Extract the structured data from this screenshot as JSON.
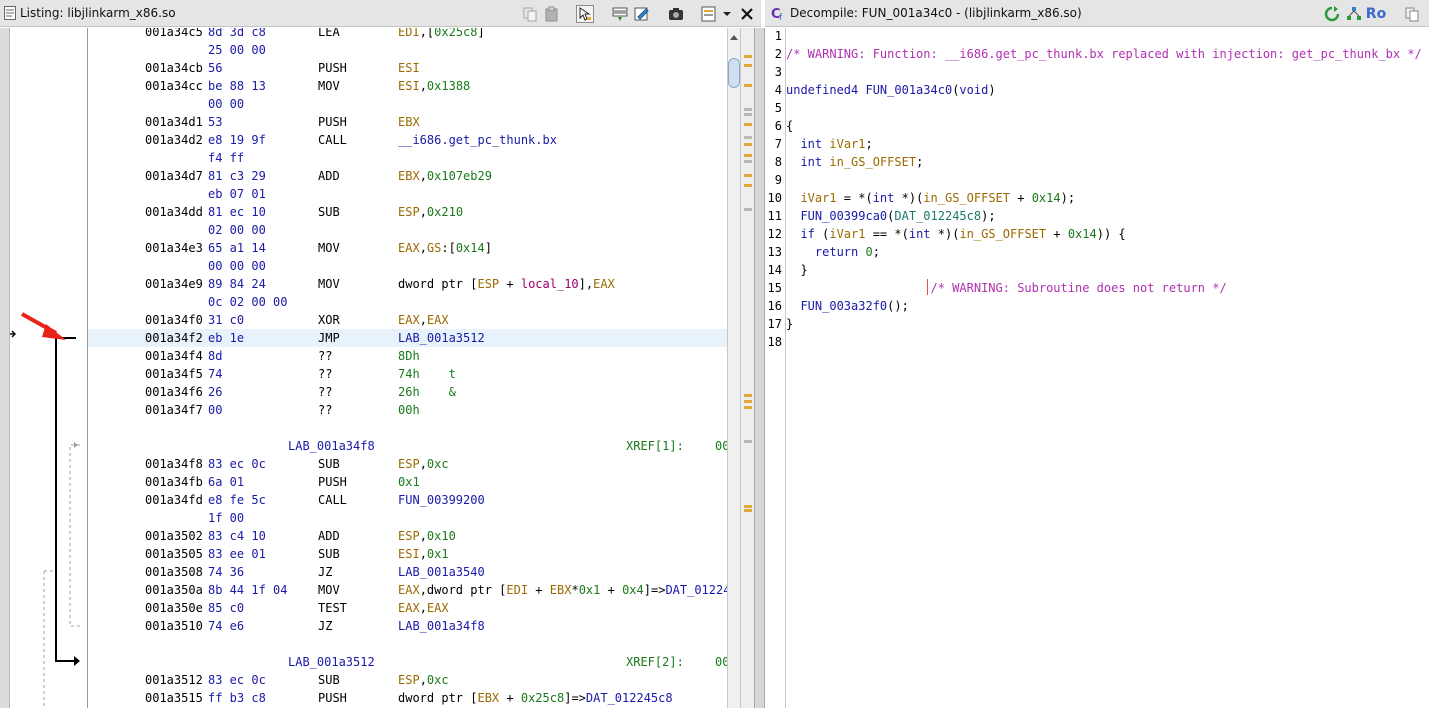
{
  "listing": {
    "title": "Listing:  libjlinkarm_x86.so",
    "rows": [
      {
        "addr": "001a34c5",
        "bytes": "8d 3d c8",
        "mn": "LEA",
        "ops": [
          {
            "t": "EDI",
            "c": "reg"
          },
          {
            "t": ",[",
            "c": "plain"
          },
          {
            "t": "0x25c8",
            "c": "num"
          },
          {
            "t": "]",
            "c": "plain"
          }
        ]
      },
      {
        "addr": "",
        "bytes": "25 00 00",
        "mn": "",
        "ops": []
      },
      {
        "addr": "001a34cb",
        "bytes": "56",
        "mn": "PUSH",
        "ops": [
          {
            "t": "ESI",
            "c": "reg"
          }
        ]
      },
      {
        "addr": "001a34cc",
        "bytes": "be 88 13",
        "mn": "MOV",
        "ops": [
          {
            "t": "ESI",
            "c": "reg"
          },
          {
            "t": ",",
            "c": "plain"
          },
          {
            "t": "0x1388",
            "c": "num"
          }
        ]
      },
      {
        "addr": "",
        "bytes": "00 00",
        "mn": "",
        "ops": []
      },
      {
        "addr": "001a34d1",
        "bytes": "53",
        "mn": "PUSH",
        "ops": [
          {
            "t": "EBX",
            "c": "reg"
          }
        ]
      },
      {
        "addr": "001a34d2",
        "bytes": "e8 19 9f",
        "mn": "CALL",
        "ops": [
          {
            "t": "__i686.get_pc_thunk.bx",
            "c": "fn"
          }
        ]
      },
      {
        "addr": "",
        "bytes": "f4 ff",
        "mn": "",
        "ops": []
      },
      {
        "addr": "001a34d7",
        "bytes": "81 c3 29",
        "mn": "ADD",
        "ops": [
          {
            "t": "EBX",
            "c": "reg"
          },
          {
            "t": ",",
            "c": "plain"
          },
          {
            "t": "0x107eb29",
            "c": "num"
          }
        ]
      },
      {
        "addr": "",
        "bytes": "eb 07 01",
        "mn": "",
        "ops": []
      },
      {
        "addr": "001a34dd",
        "bytes": "81 ec 10",
        "mn": "SUB",
        "ops": [
          {
            "t": "ESP",
            "c": "reg"
          },
          {
            "t": ",",
            "c": "plain"
          },
          {
            "t": "0x210",
            "c": "num"
          }
        ]
      },
      {
        "addr": "",
        "bytes": "02 00 00",
        "mn": "",
        "ops": []
      },
      {
        "addr": "001a34e3",
        "bytes": "65 a1 14",
        "mn": "MOV",
        "ops": [
          {
            "t": "EAX",
            "c": "reg"
          },
          {
            "t": ",",
            "c": "plain"
          },
          {
            "t": "GS",
            "c": "reg"
          },
          {
            "t": ":[",
            "c": "plain"
          },
          {
            "t": "0x14",
            "c": "num"
          },
          {
            "t": "]",
            "c": "plain"
          }
        ]
      },
      {
        "addr": "",
        "bytes": "00 00 00",
        "mn": "",
        "ops": []
      },
      {
        "addr": "001a34e9",
        "bytes": "89 84 24",
        "mn": "MOV",
        "ops": [
          {
            "t": "dword ptr [",
            "c": "plain"
          },
          {
            "t": "ESP",
            "c": "reg"
          },
          {
            "t": " + ",
            "c": "plain"
          },
          {
            "t": "local_10",
            "c": "loc"
          },
          {
            "t": "],",
            "c": "plain"
          },
          {
            "t": "EAX",
            "c": "reg"
          }
        ]
      },
      {
        "addr": "",
        "bytes": "0c 02 00 00",
        "mn": "",
        "ops": []
      },
      {
        "addr": "001a34f0",
        "bytes": "31 c0",
        "mn": "XOR",
        "ops": [
          {
            "t": "EAX",
            "c": "reg"
          },
          {
            "t": ",",
            "c": "plain"
          },
          {
            "t": "EAX",
            "c": "reg"
          }
        ]
      },
      {
        "addr": "001a34f2",
        "bytes": "eb 1e",
        "mn": "JMP",
        "ops": [
          {
            "t": "LAB_001a3512",
            "c": "fn"
          }
        ],
        "cursor": true
      },
      {
        "addr": "001a34f4",
        "bytes": "8d",
        "mn": "??",
        "ops": [
          {
            "t": "8Dh",
            "c": "num"
          }
        ]
      },
      {
        "addr": "001a34f5",
        "bytes": "74",
        "mn": "??",
        "ops": [
          {
            "t": "74h    t",
            "c": "num"
          }
        ]
      },
      {
        "addr": "001a34f6",
        "bytes": "26",
        "mn": "??",
        "ops": [
          {
            "t": "26h    &",
            "c": "num"
          }
        ]
      },
      {
        "addr": "001a34f7",
        "bytes": "00",
        "mn": "??",
        "ops": [
          {
            "t": "00h",
            "c": "num"
          }
        ]
      },
      {
        "blank": true
      },
      {
        "label": "LAB_001a34f8",
        "xref": "XREF[1]:",
        "xref2": "00"
      },
      {
        "addr": "001a34f8",
        "bytes": "83 ec 0c",
        "mn": "SUB",
        "ops": [
          {
            "t": "ESP",
            "c": "reg"
          },
          {
            "t": ",",
            "c": "plain"
          },
          {
            "t": "0xc",
            "c": "num"
          }
        ]
      },
      {
        "addr": "001a34fb",
        "bytes": "6a 01",
        "mn": "PUSH",
        "ops": [
          {
            "t": "0x1",
            "c": "num"
          }
        ]
      },
      {
        "addr": "001a34fd",
        "bytes": "e8 fe 5c",
        "mn": "CALL",
        "ops": [
          {
            "t": "FUN_00399200",
            "c": "fn"
          }
        ]
      },
      {
        "addr": "",
        "bytes": "1f 00",
        "mn": "",
        "ops": []
      },
      {
        "addr": "001a3502",
        "bytes": "83 c4 10",
        "mn": "ADD",
        "ops": [
          {
            "t": "ESP",
            "c": "reg"
          },
          {
            "t": ",",
            "c": "plain"
          },
          {
            "t": "0x10",
            "c": "num"
          }
        ]
      },
      {
        "addr": "001a3505",
        "bytes": "83 ee 01",
        "mn": "SUB",
        "ops": [
          {
            "t": "ESI",
            "c": "reg"
          },
          {
            "t": ",",
            "c": "plain"
          },
          {
            "t": "0x1",
            "c": "num"
          }
        ]
      },
      {
        "addr": "001a3508",
        "bytes": "74 36",
        "mn": "JZ",
        "ops": [
          {
            "t": "LAB_001a3540",
            "c": "fn"
          }
        ]
      },
      {
        "addr": "001a350a",
        "bytes": "8b 44 1f 04",
        "mn": "MOV",
        "ops": [
          {
            "t": "EAX",
            "c": "reg"
          },
          {
            "t": ",dword ptr [",
            "c": "plain"
          },
          {
            "t": "EDI",
            "c": "reg"
          },
          {
            "t": " + ",
            "c": "plain"
          },
          {
            "t": "EBX",
            "c": "reg"
          },
          {
            "t": "*",
            "c": "plain"
          },
          {
            "t": "0x1",
            "c": "num"
          },
          {
            "t": " + ",
            "c": "plain"
          },
          {
            "t": "0x4",
            "c": "num"
          },
          {
            "t": "]=>",
            "c": "plain"
          },
          {
            "t": "DAT_01224…",
            "c": "fn"
          }
        ]
      },
      {
        "addr": "001a350e",
        "bytes": "85 c0",
        "mn": "TEST",
        "ops": [
          {
            "t": "EAX",
            "c": "reg"
          },
          {
            "t": ",",
            "c": "plain"
          },
          {
            "t": "EAX",
            "c": "reg"
          }
        ]
      },
      {
        "addr": "001a3510",
        "bytes": "74 e6",
        "mn": "JZ",
        "ops": [
          {
            "t": "LAB_001a34f8",
            "c": "fn"
          }
        ]
      },
      {
        "blank": true
      },
      {
        "label": "LAB_001a3512",
        "xref": "XREF[2]:",
        "xref2": "00"
      },
      {
        "addr": "001a3512",
        "bytes": "83 ec 0c",
        "mn": "SUB",
        "ops": [
          {
            "t": "ESP",
            "c": "reg"
          },
          {
            "t": ",",
            "c": "plain"
          },
          {
            "t": "0xc",
            "c": "num"
          }
        ]
      },
      {
        "addr": "001a3515",
        "bytes": "ff b3 c8",
        "mn": "PUSH",
        "ops": [
          {
            "t": "dword ptr [",
            "c": "plain"
          },
          {
            "t": "EBX",
            "c": "reg"
          },
          {
            "t": " + ",
            "c": "plain"
          },
          {
            "t": "0x25c8",
            "c": "num"
          },
          {
            "t": "]=>",
            "c": "plain"
          },
          {
            "t": "DAT_012245c8",
            "c": "fn"
          }
        ]
      }
    ]
  },
  "decompile": {
    "title": "Decompile: FUN_001a34c0 -  (libjlinkarm_x86.so)",
    "ro_label": "Ro",
    "lines": [
      {
        "n": "1",
        "segs": []
      },
      {
        "n": "2",
        "segs": [
          {
            "t": "/* WARNING: Function: __i686.get_pc_thunk.bx replaced with injection: get_pc_thunk_bx */",
            "c": "cmt"
          }
        ]
      },
      {
        "n": "3",
        "segs": []
      },
      {
        "n": "4",
        "segs": [
          {
            "t": "undefined4 ",
            "c": "kw"
          },
          {
            "t": "FUN_001a34c0",
            "c": "fn"
          },
          {
            "t": "(",
            "c": "plain"
          },
          {
            "t": "void",
            "c": "kw"
          },
          {
            "t": ")",
            "c": "plain"
          }
        ]
      },
      {
        "n": "5",
        "segs": []
      },
      {
        "n": "6",
        "segs": [
          {
            "t": "{",
            "c": "plain"
          }
        ]
      },
      {
        "n": "7",
        "segs": [
          {
            "t": "  ",
            "c": "plain"
          },
          {
            "t": "int",
            "c": "kw"
          },
          {
            "t": " ",
            "c": "plain"
          },
          {
            "t": "iVar1",
            "c": "var"
          },
          {
            "t": ";",
            "c": "plain"
          }
        ]
      },
      {
        "n": "8",
        "segs": [
          {
            "t": "  ",
            "c": "plain"
          },
          {
            "t": "int",
            "c": "kw"
          },
          {
            "t": " ",
            "c": "plain"
          },
          {
            "t": "in_GS_OFFSET",
            "c": "var"
          },
          {
            "t": ";",
            "c": "plain"
          }
        ]
      },
      {
        "n": "9",
        "segs": []
      },
      {
        "n": "10",
        "segs": [
          {
            "t": "  ",
            "c": "plain"
          },
          {
            "t": "iVar1",
            "c": "var"
          },
          {
            "t": " = *(",
            "c": "plain"
          },
          {
            "t": "int",
            "c": "kw"
          },
          {
            "t": " *)(",
            "c": "plain"
          },
          {
            "t": "in_GS_OFFSET",
            "c": "var"
          },
          {
            "t": " + ",
            "c": "plain"
          },
          {
            "t": "0x14",
            "c": "num"
          },
          {
            "t": ");",
            "c": "plain"
          }
        ]
      },
      {
        "n": "11",
        "segs": [
          {
            "t": "  ",
            "c": "plain"
          },
          {
            "t": "FUN_00399ca0",
            "c": "fn"
          },
          {
            "t": "(",
            "c": "plain"
          },
          {
            "t": "DAT_012245c8",
            "c": "glob"
          },
          {
            "t": ");",
            "c": "plain"
          }
        ]
      },
      {
        "n": "12",
        "segs": [
          {
            "t": "  ",
            "c": "plain"
          },
          {
            "t": "if",
            "c": "kw"
          },
          {
            "t": " (",
            "c": "plain"
          },
          {
            "t": "iVar1",
            "c": "var"
          },
          {
            "t": " == *(",
            "c": "plain"
          },
          {
            "t": "int",
            "c": "kw"
          },
          {
            "t": " *)(",
            "c": "plain"
          },
          {
            "t": "in_GS_OFFSET",
            "c": "var"
          },
          {
            "t": " + ",
            "c": "plain"
          },
          {
            "t": "0x14",
            "c": "num"
          },
          {
            "t": ")) {",
            "c": "plain"
          }
        ]
      },
      {
        "n": "13",
        "segs": [
          {
            "t": "    ",
            "c": "plain"
          },
          {
            "t": "return",
            "c": "kw"
          },
          {
            "t": " ",
            "c": "plain"
          },
          {
            "t": "0",
            "c": "num"
          },
          {
            "t": ";",
            "c": "plain"
          }
        ]
      },
      {
        "n": "14",
        "segs": [
          {
            "t": "  }",
            "c": "plain"
          }
        ]
      },
      {
        "n": "15",
        "segs": [
          {
            "t": "                    /* WARNING: Subroutine does not return */",
            "c": "cmt"
          }
        ]
      },
      {
        "n": "16",
        "segs": [
          {
            "t": "  ",
            "c": "plain"
          },
          {
            "t": "FUN_003a32f0",
            "c": "fn"
          },
          {
            "t": "();",
            "c": "plain"
          }
        ]
      },
      {
        "n": "17",
        "segs": [
          {
            "t": "}",
            "c": "plain"
          }
        ]
      },
      {
        "n": "18",
        "segs": []
      }
    ]
  },
  "icons": {
    "listing": [
      "copy-icon",
      "paste-icon",
      "cursor-select-icon",
      "field-edit-icon",
      "byte-edit-icon",
      "snapshot-icon",
      "navigation-icon",
      "menu-chevron-icon",
      "close-icon"
    ],
    "decompile": [
      "refresh-icon",
      "graph-icon",
      "ro-toggle",
      "copy-window-icon"
    ]
  },
  "colors": {
    "register": "#9a6a00",
    "number": "#1a7a1a",
    "function": "#1a1aa8",
    "comment": "#b030b0",
    "arrow": "#e8231a",
    "overview_mark": "#e3a83a"
  }
}
